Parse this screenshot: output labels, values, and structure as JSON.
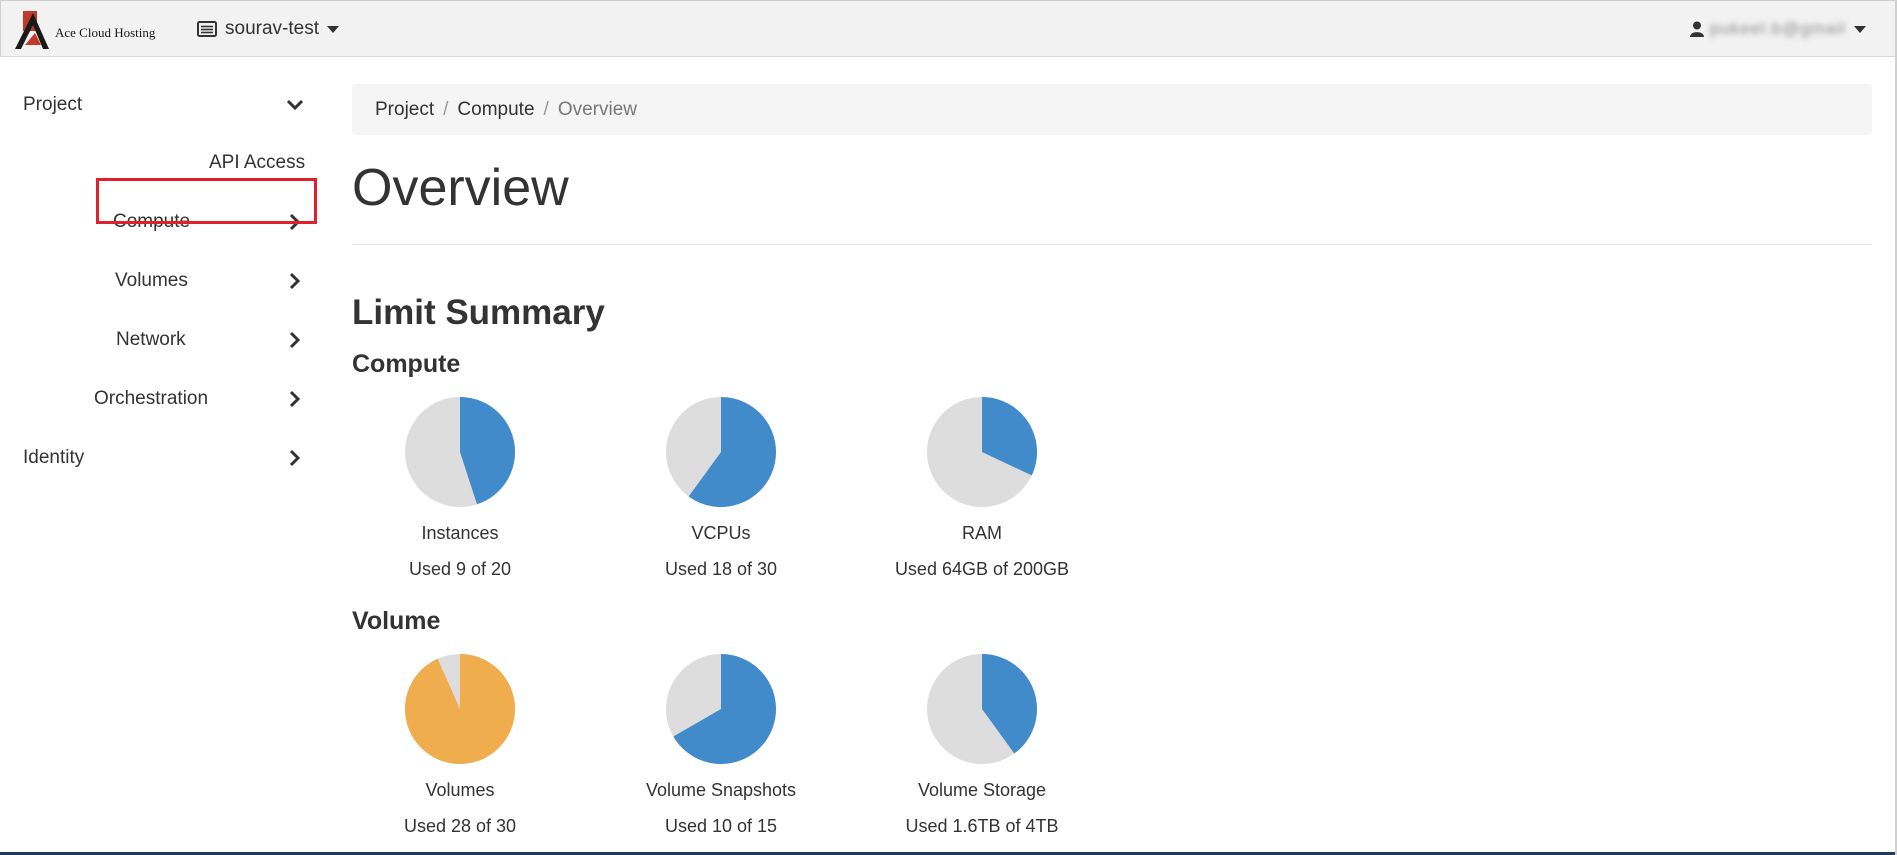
{
  "navbar": {
    "brand_text": "Ace Cloud Hosting",
    "project_name": "sourav-test",
    "user_name": "pukeel.b@gmail"
  },
  "sidebar": {
    "items": [
      {
        "label": "Project",
        "icon": "chevron-down-icon"
      },
      {
        "label": "API Access",
        "icon": ""
      },
      {
        "label": "Compute",
        "icon": "chevron-right-icon",
        "active": true
      },
      {
        "label": "Volumes",
        "icon": "chevron-right-icon"
      },
      {
        "label": "Network",
        "icon": "chevron-right-icon"
      },
      {
        "label": "Orchestration",
        "icon": "chevron-right-icon"
      },
      {
        "label": "Identity",
        "icon": "chevron-right-icon"
      }
    ]
  },
  "breadcrumb": {
    "items": [
      "Project",
      "Compute"
    ],
    "current": "Overview",
    "separator": "/"
  },
  "page": {
    "title": "Overview",
    "section_title": "Limit Summary"
  },
  "colors": {
    "normal": "#428bca",
    "warning": "#f0ad4e",
    "empty": "#dddddd",
    "active_highlight": "#e0202a"
  },
  "chart_data": [
    {
      "type": "pie",
      "group": "Compute",
      "charts": [
        {
          "label": "Instances",
          "usage": "Used 9 of 20",
          "used": 9,
          "total": 20,
          "color": "#428bca"
        },
        {
          "label": "VCPUs",
          "usage": "Used 18 of 30",
          "used": 18,
          "total": 30,
          "color": "#428bca"
        },
        {
          "label": "RAM",
          "usage": "Used 64GB of 200GB",
          "used": 64,
          "total": 200,
          "color": "#428bca"
        }
      ]
    },
    {
      "type": "pie",
      "group": "Volume",
      "charts": [
        {
          "label": "Volumes",
          "usage": "Used 28 of 30",
          "used": 28,
          "total": 30,
          "color": "#f0ad4e"
        },
        {
          "label": "Volume Snapshots",
          "usage": "Used 10 of 15",
          "used": 10,
          "total": 15,
          "color": "#428bca"
        },
        {
          "label": "Volume Storage",
          "usage": "Used 1.6TB of 4TB",
          "used": 1.6,
          "total": 4,
          "color": "#428bca"
        }
      ]
    }
  ]
}
